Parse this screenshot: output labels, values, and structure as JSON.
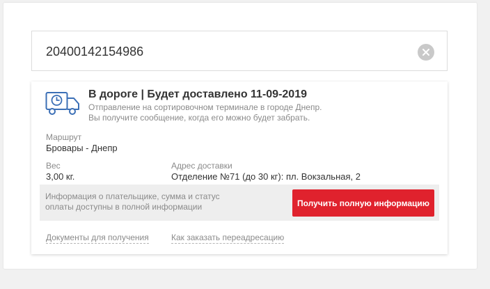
{
  "search": {
    "value": "20400142154986"
  },
  "status": {
    "title": "В дороге | Будет доставлено 11-09-2019",
    "line1": "Отправление на сортировочном терминале в городе Днепр.",
    "line2": "Вы получите сообщение, когда его можно будет забрать."
  },
  "route": {
    "label": "Маршрут",
    "value": "Бровары - Днепр"
  },
  "weight": {
    "label": "Вес",
    "value": "3,00 кг."
  },
  "address": {
    "label": "Адрес доставки",
    "value": "Отделение №71 (до 30 кг): пл. Вокзальная, 2"
  },
  "info": {
    "line1": "Информация о плательщике, сумма и статус",
    "line2": "оплаты доступны в полной информации",
    "button_label": "Получить полную информацию"
  },
  "links": {
    "documents": "Документы для получения",
    "redirect": "Как заказать переадресацию"
  },
  "icons": {
    "truck": "truck-clock-icon",
    "clear": "close-icon"
  },
  "colors": {
    "accent": "#e0222d",
    "icon": "#3b6fb6"
  }
}
